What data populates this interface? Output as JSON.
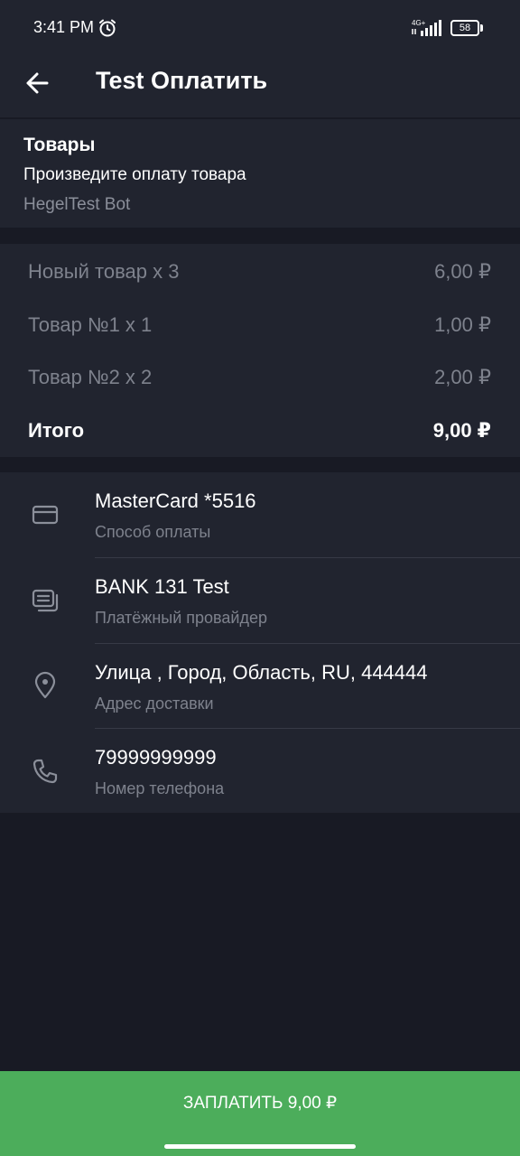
{
  "status_bar": {
    "time": "3:41 PM",
    "network": "4G+",
    "battery": "58",
    "icons": [
      "alarm-icon",
      "signal-icon",
      "battery-icon"
    ]
  },
  "app_bar": {
    "title": "Test Оплатить",
    "back_icon": "arrow-left-icon"
  },
  "invoice": {
    "title": "Товары",
    "description": "Произведите оплату товара",
    "bot_name": "HegelTest Bot"
  },
  "items": [
    {
      "name": "Новый товар x 3",
      "price": "6,00 ₽"
    },
    {
      "name": "Товар №1 x 1",
      "price": "1,00 ₽"
    },
    {
      "name": "Товар №2 x 2",
      "price": "2,00 ₽"
    }
  ],
  "total": {
    "label": "Итого",
    "price": "9,00 ₽"
  },
  "details": [
    {
      "value": "MasterCard *5516",
      "label": "Способ оплаты",
      "icon": "credit-card-icon"
    },
    {
      "value": "BANK 131 Test",
      "label": "Платёжный провайдер",
      "icon": "provider-icon"
    },
    {
      "value": "Улица , Город, Область, RU, 444444",
      "label": "Адрес доставки",
      "icon": "location-pin-icon"
    },
    {
      "value": "79999999999",
      "label": "Номер телефона",
      "icon": "phone-icon"
    }
  ],
  "pay_button": {
    "label": "ЗАПЛАТИТЬ 9,00 ₽"
  },
  "colors": {
    "background": "#181a24",
    "surface": "#21242f",
    "accent": "#4cad5b",
    "secondary_text": "#7e828d"
  }
}
